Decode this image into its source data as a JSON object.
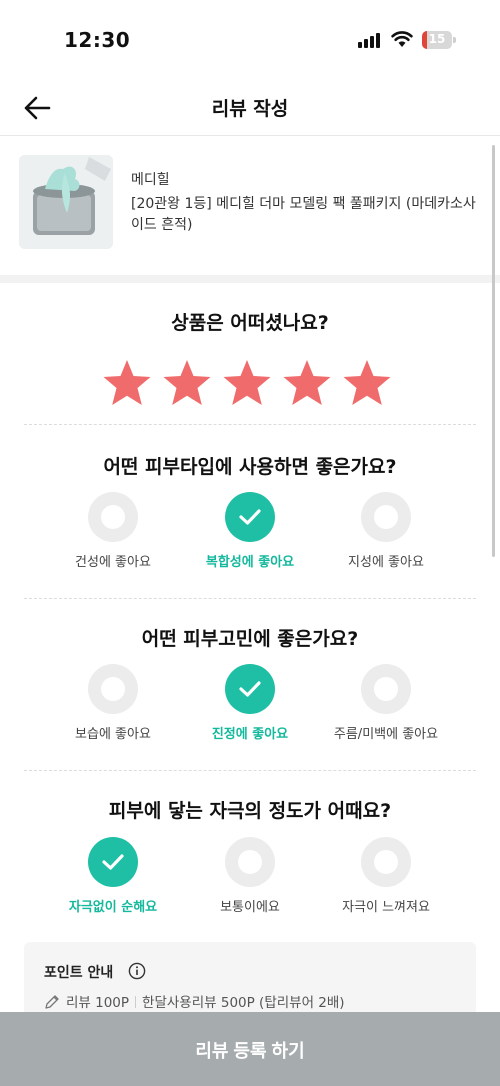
{
  "status_bar": {
    "time": "12:30",
    "battery": "15",
    "battery_level": 0.15
  },
  "header": {
    "title": "리뷰 작성"
  },
  "product": {
    "brand": "메디힐",
    "name": "[20관왕 1등] 메디힐 더마 모델링 팩 풀패키지 (마데카소사이드 흔적)"
  },
  "rating": {
    "question": "상품은 어떠셨나요?",
    "value": 5,
    "max": 5,
    "star_color": "#f06b6b"
  },
  "skin_type": {
    "question": "어떤 피부타입에 사용하면 좋은가요?",
    "options": [
      "건성에 좋아요",
      "복합성에 좋아요",
      "지성에 좋아요"
    ],
    "selected": "복합성에 좋아요"
  },
  "skin_concern": {
    "question": "어떤 피부고민에 좋은가요?",
    "options": [
      "보습에 좋아요",
      "진정에 좋아요",
      "주름/미백에 좋아요"
    ],
    "selected": "진정에 좋아요"
  },
  "irritation": {
    "question": "피부에 닿는 자극의 정도가 어때요?",
    "options": [
      "자극없이 순해요",
      "보통이에요",
      "자극이 느껴져요"
    ],
    "selected": "자극없이 순해요"
  },
  "points": {
    "title": "포인트 안내",
    "review_point": "리뷰 100P",
    "month_review_point": "한달사용리뷰 500P (탑리뷰어 2배)"
  },
  "submit": {
    "label": "리뷰 등록 하기"
  },
  "colors": {
    "accent": "#1fbfa5",
    "submit_bg": "#a6abae"
  }
}
